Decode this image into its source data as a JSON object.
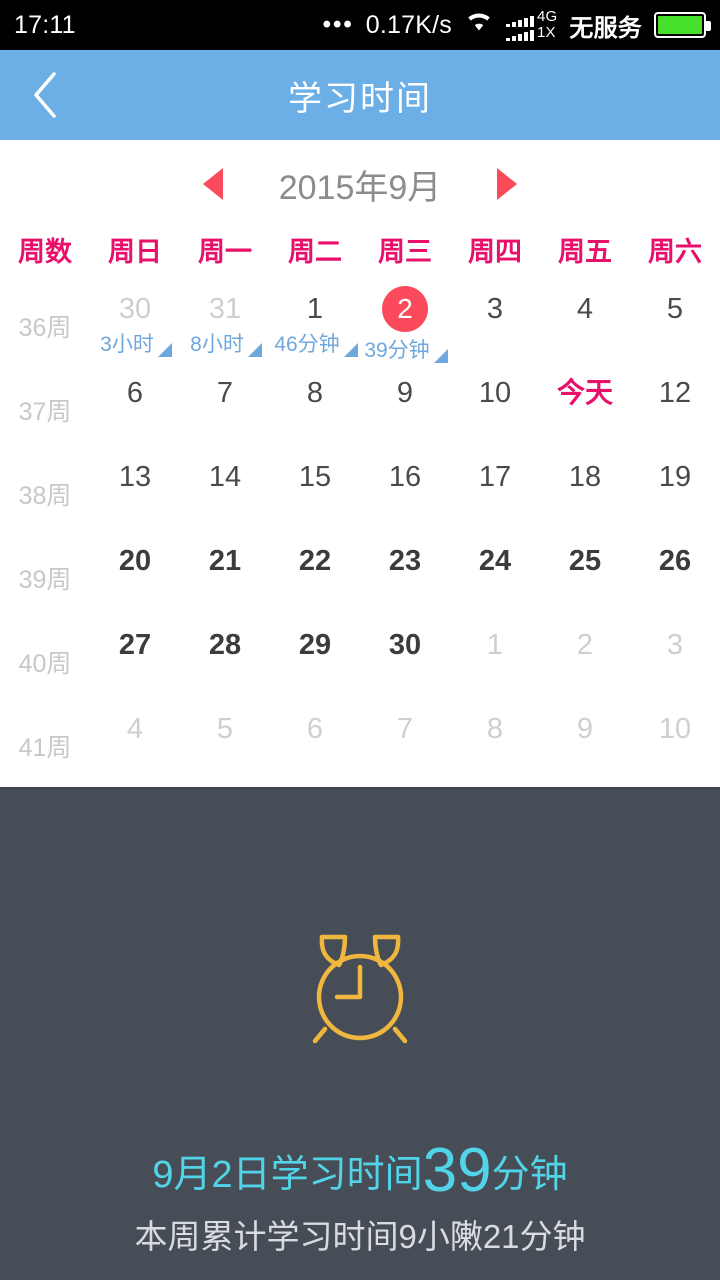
{
  "status_bar": {
    "time": "17:11",
    "dots": "•••",
    "net_speed": "0.17K/s",
    "wifi_icon": "wifi-icon",
    "signal_label_top": "4G",
    "signal_label_bottom": "1X",
    "carrier": "无服务",
    "battery_icon": "battery-icon",
    "battery_color": "#46E02A"
  },
  "header": {
    "title": "学习时间",
    "back_icon": "back-chevron-icon",
    "bg_color": "#6CAEE6"
  },
  "month_nav": {
    "prev_icon": "triangle-left-icon",
    "next_icon": "triangle-right-icon",
    "label": "2015年9月",
    "arrow_color": "#FA4A5C"
  },
  "calendar": {
    "header_color": "#E8106A",
    "columns": [
      "周数",
      "周日",
      "周一",
      "周二",
      "周三",
      "周四",
      "周五",
      "周六"
    ],
    "selected_color": "#FA4A5C",
    "duration_color": "#6FA8DC",
    "rows": [
      {
        "week": "36周",
        "days": [
          {
            "label": "30",
            "state": "muted",
            "duration": "3小时"
          },
          {
            "label": "31",
            "state": "muted",
            "duration": "8小时"
          },
          {
            "label": "1",
            "state": "normal",
            "duration": "46分钟"
          },
          {
            "label": "2",
            "state": "selected",
            "duration": "39分钟"
          },
          {
            "label": "3",
            "state": "normal",
            "duration": ""
          },
          {
            "label": "4",
            "state": "normal",
            "duration": ""
          },
          {
            "label": "5",
            "state": "normal",
            "duration": ""
          }
        ]
      },
      {
        "week": "37周",
        "days": [
          {
            "label": "6",
            "state": "normal",
            "duration": ""
          },
          {
            "label": "7",
            "state": "normal",
            "duration": ""
          },
          {
            "label": "8",
            "state": "normal",
            "duration": ""
          },
          {
            "label": "9",
            "state": "normal",
            "duration": ""
          },
          {
            "label": "10",
            "state": "normal",
            "duration": ""
          },
          {
            "label": "今天",
            "state": "today",
            "duration": ""
          },
          {
            "label": "12",
            "state": "normal",
            "duration": ""
          }
        ]
      },
      {
        "week": "38周",
        "days": [
          {
            "label": "13",
            "state": "normal",
            "duration": ""
          },
          {
            "label": "14",
            "state": "normal",
            "duration": ""
          },
          {
            "label": "15",
            "state": "normal",
            "duration": ""
          },
          {
            "label": "16",
            "state": "normal",
            "duration": ""
          },
          {
            "label": "17",
            "state": "normal",
            "duration": ""
          },
          {
            "label": "18",
            "state": "normal",
            "duration": ""
          },
          {
            "label": "19",
            "state": "normal",
            "duration": ""
          }
        ]
      },
      {
        "week": "39周",
        "days": [
          {
            "label": "20",
            "state": "bold",
            "duration": ""
          },
          {
            "label": "21",
            "state": "bold",
            "duration": ""
          },
          {
            "label": "22",
            "state": "bold",
            "duration": ""
          },
          {
            "label": "23",
            "state": "bold",
            "duration": ""
          },
          {
            "label": "24",
            "state": "bold",
            "duration": ""
          },
          {
            "label": "25",
            "state": "bold",
            "duration": ""
          },
          {
            "label": "26",
            "state": "bold",
            "duration": ""
          }
        ]
      },
      {
        "week": "40周",
        "days": [
          {
            "label": "27",
            "state": "bold",
            "duration": ""
          },
          {
            "label": "28",
            "state": "bold",
            "duration": ""
          },
          {
            "label": "29",
            "state": "bold",
            "duration": ""
          },
          {
            "label": "30",
            "state": "bold",
            "duration": ""
          },
          {
            "label": "1",
            "state": "muted",
            "duration": ""
          },
          {
            "label": "2",
            "state": "muted",
            "duration": ""
          },
          {
            "label": "3",
            "state": "muted",
            "duration": ""
          }
        ]
      },
      {
        "week": "41周",
        "days": [
          {
            "label": "4",
            "state": "muted",
            "duration": ""
          },
          {
            "label": "5",
            "state": "muted",
            "duration": ""
          },
          {
            "label": "6",
            "state": "muted",
            "duration": ""
          },
          {
            "label": "7",
            "state": "muted",
            "duration": ""
          },
          {
            "label": "8",
            "state": "muted",
            "duration": ""
          },
          {
            "label": "9",
            "state": "muted",
            "duration": ""
          },
          {
            "label": "10",
            "state": "muted",
            "duration": ""
          }
        ]
      }
    ]
  },
  "detail_panel": {
    "bg_color": "#474D56",
    "clock_icon": "alarm-clock-icon",
    "clock_color": "#F0B73E",
    "summary_prefix": "9月2日学习时间",
    "summary_value": "39",
    "summary_unit": "分钟",
    "summary_color": "#52D4E8",
    "week_total": "本周累计学习时间9小敶21分钟"
  }
}
